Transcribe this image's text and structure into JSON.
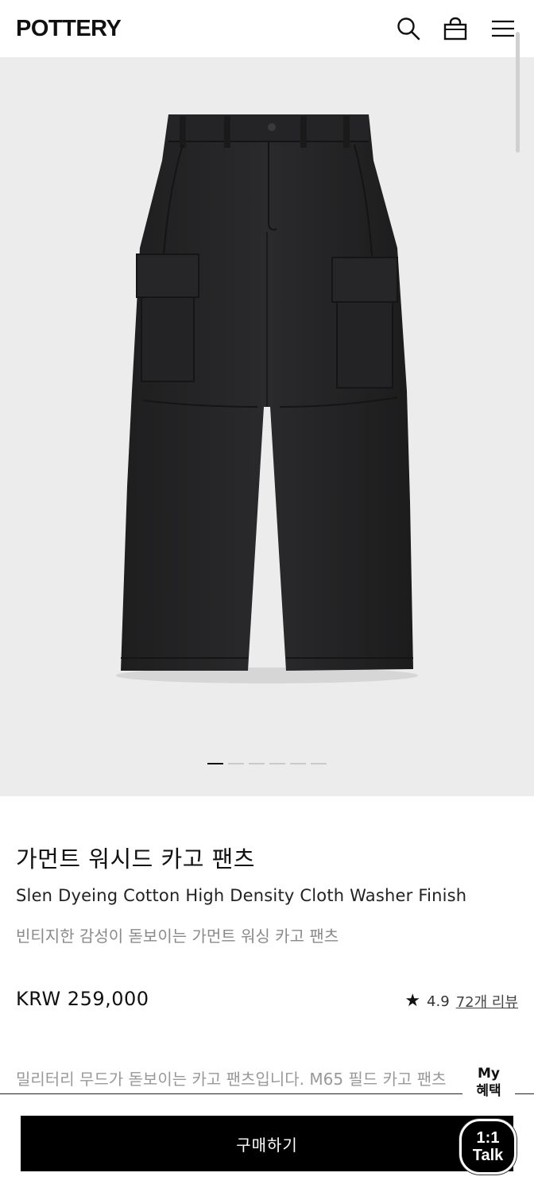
{
  "header": {
    "logo": "POTTERY",
    "icons": [
      "search-icon",
      "shopping-bag-icon",
      "menu-icon"
    ]
  },
  "gallery": {
    "image": "black-cargo-pants-photo",
    "slide_count": 6,
    "active_slide": 1,
    "background": "#ececec"
  },
  "product": {
    "name": "가먼트 워시드 카고 팬츠",
    "name_en": "Slen Dyeing Cotton High Density Cloth Washer Finish",
    "description": "빈티지한 감성이 돋보이는 가먼트 워싱 카고 팬츠",
    "price": "KRW 259,000",
    "rating": "4.9",
    "review_link": "72개 리뷰",
    "summary": "밀리터리 무드가 돋보이는 카고 팬츠입니다. M65 필드 카고 팬츠"
  },
  "floating": {
    "my_benefit_line1": "My",
    "my_benefit_line2": "혜택",
    "talk_line1": "1:1",
    "talk_line2": "Talk"
  },
  "actions": {
    "buy_label": "구매하기"
  },
  "colors": {
    "accent": "#000000",
    "gallery_bg": "#ececec",
    "muted_text": "#8a8a8a"
  }
}
